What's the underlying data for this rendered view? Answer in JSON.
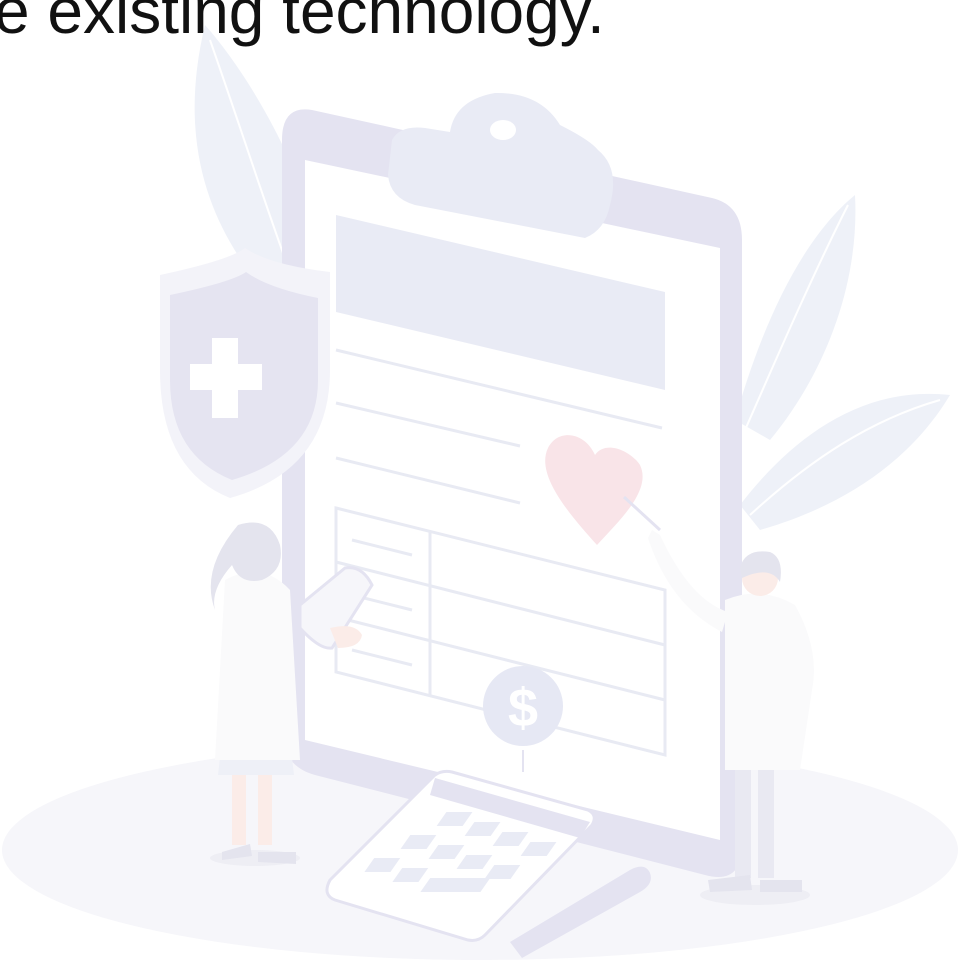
{
  "headline": {
    "text": "e existing technology."
  },
  "illustration": {
    "subject": "healthcare-billing-clipboard",
    "colors": {
      "ground": "#f6f6fa",
      "board": "#e4e3f1",
      "sheet": "#ffffff",
      "banner": "#e9ebf5",
      "line": "#e8eaf3",
      "leaf": "#eef1f8",
      "shield_outer": "#f3f3f9",
      "shield_inner": "#e5e4f1",
      "heart": "#f9e4e8",
      "coin": "#e6e8f4",
      "person_dark": "#e4e4ee",
      "coat": "#fafafb",
      "skin": "#fbece8"
    },
    "glyphs": {
      "coin_symbol": "$"
    }
  }
}
